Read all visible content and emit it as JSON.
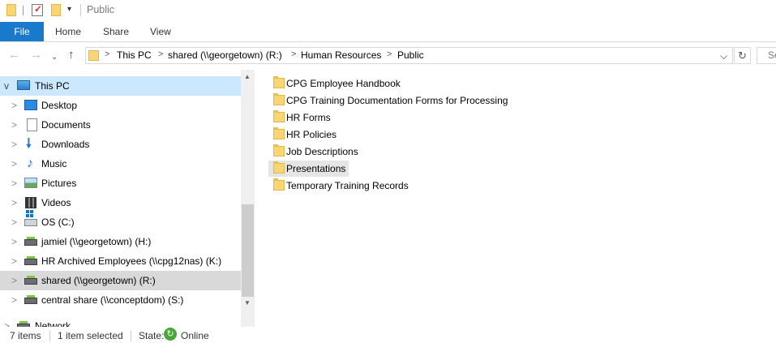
{
  "window": {
    "title": "Public"
  },
  "quick_access": {
    "customize_glyph": "▾"
  },
  "ribbon": {
    "tabs": [
      "File",
      "Home",
      "Share",
      "View"
    ]
  },
  "address": {
    "back_glyph": "←",
    "forward_glyph": "→",
    "up_glyph": "↑",
    "crumbs": [
      "This PC",
      "shared (\\\\georgetown) (R:)",
      "Human Resources",
      "Public"
    ],
    "crumb_separator": ">",
    "dropdown_glyph": "⌵",
    "refresh_glyph": "↻",
    "search_placeholder": "Se"
  },
  "nav_pane": {
    "expand_glyph": ">",
    "collapse_glyph": "v",
    "root": "This PC",
    "items": [
      {
        "label": "Desktop",
        "icon": "desktop-icon"
      },
      {
        "label": "Documents",
        "icon": "documents-icon"
      },
      {
        "label": "Downloads",
        "icon": "downloads-icon"
      },
      {
        "label": "Music",
        "icon": "music-icon"
      },
      {
        "label": "Pictures",
        "icon": "pictures-icon"
      },
      {
        "label": "Videos",
        "icon": "videos-icon"
      },
      {
        "label": "OS (C:)",
        "icon": "local-drive-icon"
      },
      {
        "label": "jamiel (\\\\georgetown) (H:)",
        "icon": "network-drive-icon"
      },
      {
        "label": "HR Archived Employees (\\\\cpg12nas) (K:)",
        "icon": "network-drive-icon"
      },
      {
        "label": "shared (\\\\georgetown) (R:)",
        "icon": "network-drive-icon",
        "selected": true
      },
      {
        "label": "central share (\\\\conceptdom) (S:)",
        "icon": "network-drive-icon"
      },
      {
        "label": "Network",
        "icon": "network-icon"
      }
    ]
  },
  "files": [
    {
      "name": "CPG Employee Handbook"
    },
    {
      "name": "CPG Training Documentation Forms for Processing"
    },
    {
      "name": "HR Forms"
    },
    {
      "name": "HR Policies"
    },
    {
      "name": "Job Descriptions"
    },
    {
      "name": "Presentations",
      "selected": true
    },
    {
      "name": "Temporary Training Records"
    }
  ],
  "status": {
    "item_count": "7 items",
    "selection": "1 item selected",
    "state_label": "State:",
    "state_value": "Online"
  },
  "colors": {
    "file_tab": "#1979ca",
    "folder": "#f7d673",
    "nav_highlight": "#cce8ff",
    "selection": "#d9d9d9"
  }
}
